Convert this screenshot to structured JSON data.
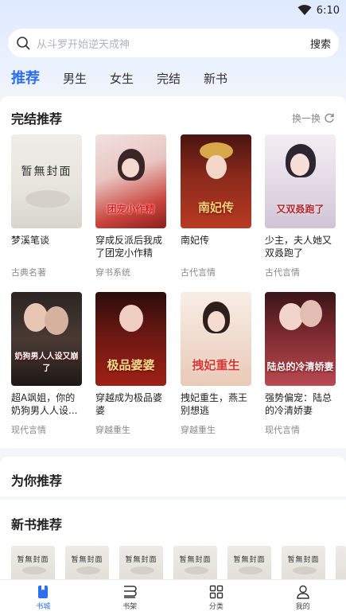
{
  "status": {
    "time": "6:10",
    "icon": "wifi-icon"
  },
  "search": {
    "placeholder": "从斗罗开始逆天成神",
    "button": "搜索"
  },
  "tabs": [
    {
      "label": "推荐",
      "active": true
    },
    {
      "label": "男生"
    },
    {
      "label": "女生"
    },
    {
      "label": "完结"
    },
    {
      "label": "新书"
    }
  ],
  "completed": {
    "title": "完结推荐",
    "refresh": "换一换",
    "books": [
      {
        "title": "梦溪笔谈",
        "category": "古典名著",
        "cover_text": "暂無封面"
      },
      {
        "title": "穿成反派后我成了团宠小作精",
        "category": "穿书系统",
        "cover_text": "团宠小作精"
      },
      {
        "title": "南妃传",
        "category": "古代言情",
        "cover_text": "南妃传"
      },
      {
        "title": "少主，夫人她又双叒跑了",
        "category": "古代言情",
        "cover_text": "又双叒跑了"
      },
      {
        "title": "超A飒姐，你的奶狗男人人设又崩了",
        "title_display": "超A飒姐，你的奶狗男人人设...",
        "category": "现代言情",
        "cover_text": "奶狗男人人设又崩了"
      },
      {
        "title": "穿越成为极品婆婆",
        "category": "穿越重生",
        "cover_text": "极品婆婆"
      },
      {
        "title": "拽妃重生，燕王别想逃",
        "category": "穿越重生",
        "cover_text": "拽妃重生"
      },
      {
        "title": "强势偏宠：陆总的冷清娇妻",
        "category": "现代言情",
        "cover_text": "陆总的冷清娇妻"
      }
    ]
  },
  "for_you": {
    "title": "为你推荐"
  },
  "new_books": {
    "title": "新书推荐",
    "cover_text": "暂無封面"
  },
  "bottom_nav": [
    {
      "label": "书城",
      "icon": "bookstore-icon",
      "active": true
    },
    {
      "label": "书架",
      "icon": "bookshelf-icon"
    },
    {
      "label": "分类",
      "icon": "category-icon"
    },
    {
      "label": "我的",
      "icon": "profile-icon"
    }
  ],
  "colors": {
    "accent": "#2c6df2",
    "background": "#f3f5f8"
  }
}
